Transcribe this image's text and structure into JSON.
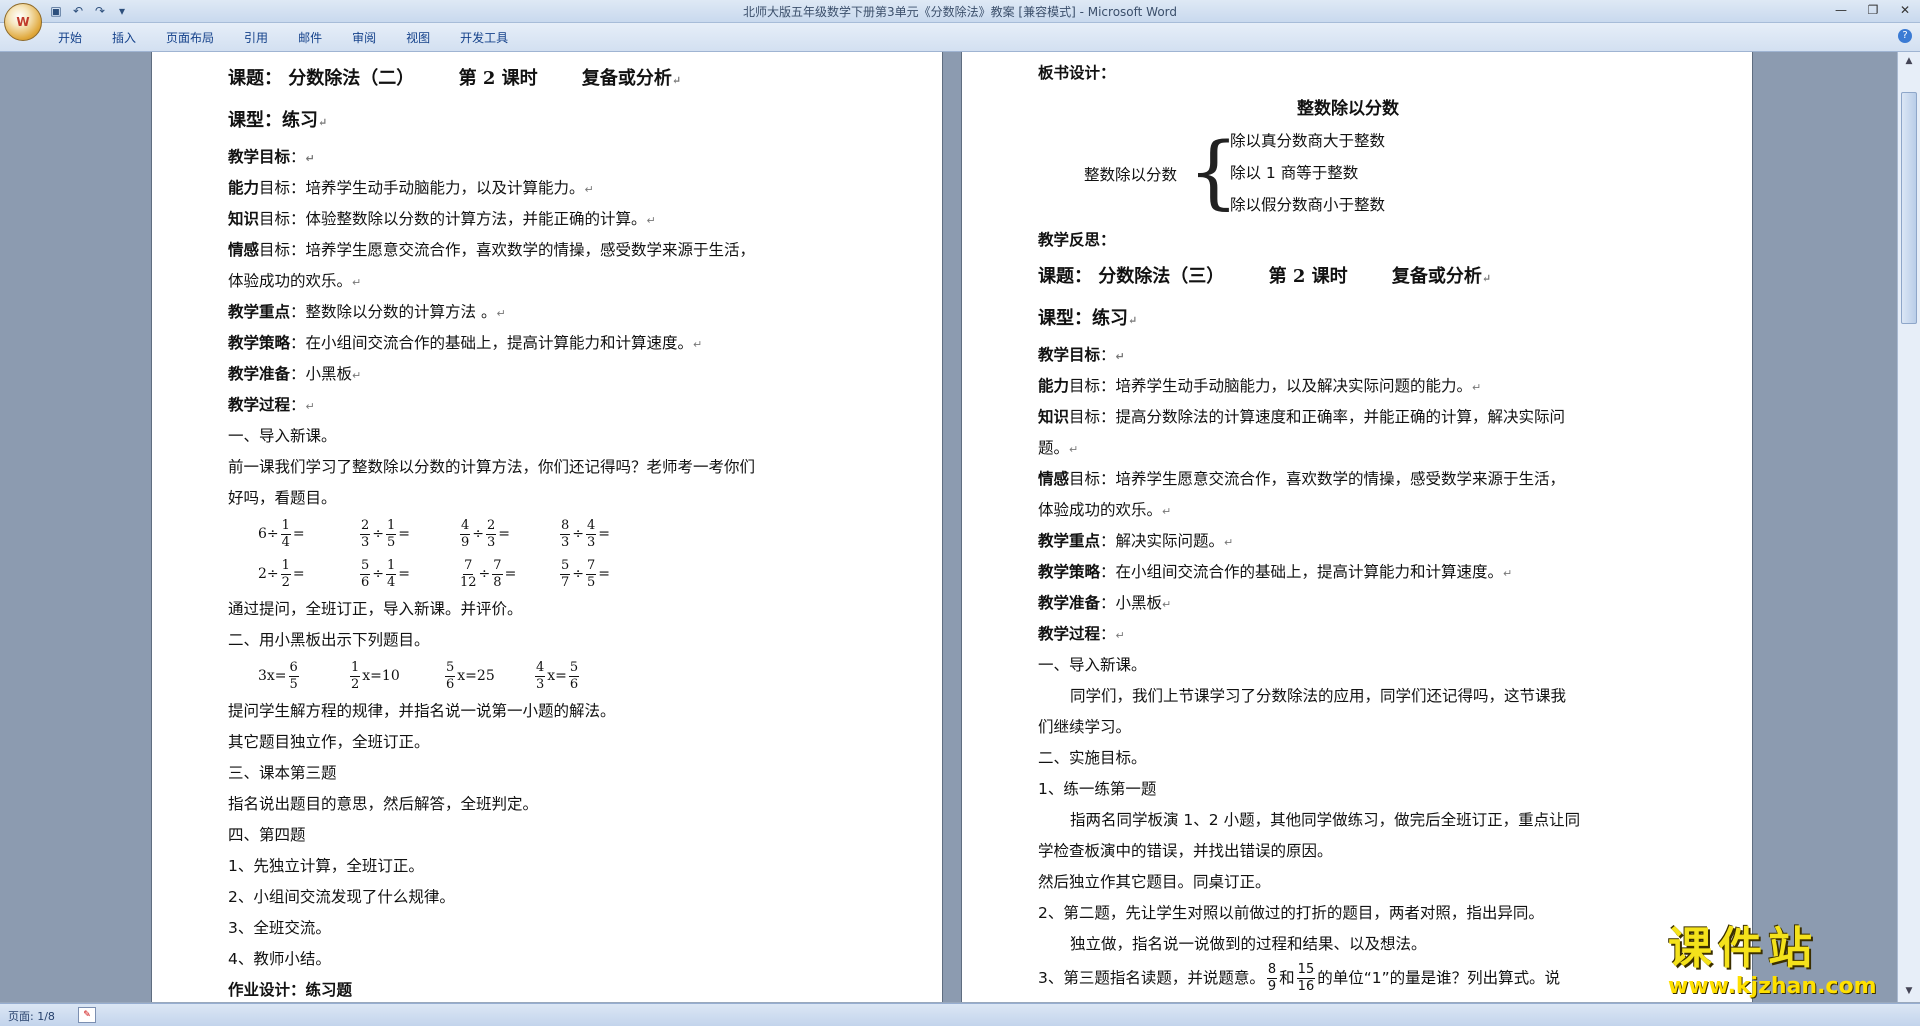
{
  "window": {
    "title": "北师大版五年级数学下册第3单元《分数除法》教案 [兼容模式] - Microsoft Word",
    "office_button_label": "W",
    "qat": [
      "save-icon",
      "undo-icon",
      "redo-icon",
      "customize-icon"
    ],
    "controls": [
      "—",
      "❐",
      "✕"
    ]
  },
  "ribbon_tabs": [
    "开始",
    "插入",
    "页面布局",
    "引用",
    "邮件",
    "审阅",
    "视图",
    "开发工具"
  ],
  "page1": {
    "title": [
      "课题：",
      "分数除法（二）",
      "第 2 课时",
      "复备或分析"
    ],
    "type_label": "课型：",
    "type_value": "练习",
    "objectives_label": "教学目标",
    "line_ability_b": "能力",
    "line_ability": "目标：培养学生动手动脑能力，以及计算能力。",
    "line_know_b": "知识",
    "line_know": "目标：体验整数除以分数的计算方法，并能正确的计算。",
    "line_emotion_b": "情感",
    "line_emotion": "目标：培养学生愿意交流合作，喜欢数学的情操，感受数学来源于生活，",
    "line_emotion2": "体验成功的欢乐。",
    "focus_b": "教学重点",
    "focus": "：整数除以分数的计算方法 。",
    "strategy_b": "教学策略",
    "strategy": "：在小组间交流合作的基础上，提高计算能力和计算速度。",
    "prep_b": "教学准备",
    "prep": "：小黑板",
    "process_b": "教学过程",
    "s1": "一、导入新课。",
    "s1a": "前一课我们学习了整数除以分数的计算方法，你们还记得吗？老师考一考你们",
    "s1b": "好吗，看题目。",
    "row1": [
      {
        "lead": "6÷",
        "n": "1",
        "d": "4",
        "tail": "="
      },
      {
        "n": "2",
        "d": "3",
        "op": "÷",
        "n2": "1",
        "d2": "5",
        "tail": "="
      },
      {
        "n": "4",
        "d": "9",
        "op": "÷",
        "n2": "2",
        "d2": "3",
        "tail": "="
      },
      {
        "n": "8",
        "d": "3",
        "op": "÷",
        "n2": "4",
        "d2": "3",
        "tail": "="
      }
    ],
    "row2": [
      {
        "lead": "2÷",
        "n": "1",
        "d": "2",
        "tail": "="
      },
      {
        "n": "5",
        "d": "6",
        "op": "÷",
        "n2": "1",
        "d2": "4",
        "tail": "="
      },
      {
        "n": "7",
        "d": "12",
        "op": "÷",
        "n2": "7",
        "d2": "8",
        "tail": "="
      },
      {
        "n": "5",
        "d": "7",
        "op": "÷",
        "n2": "7",
        "d2": "5",
        "tail": "="
      }
    ],
    "s1c": "通过提问，全班订正，导入新课。并评价。",
    "s2": "二、用小黑板出示下列题目。",
    "eq": [
      {
        "lead": "3x=",
        "n": "6",
        "d": "5",
        "tail": ""
      },
      {
        "lead": "",
        "n": "1",
        "d": "2",
        "tail": "x=10"
      },
      {
        "lead": "",
        "n": "5",
        "d": "6",
        "tail": "x=25"
      },
      {
        "lead": "",
        "n": "4",
        "d": "3",
        "tail": "x=",
        "n2": "5",
        "d2": "6"
      }
    ],
    "s2a": "提问学生解方程的规律，并指名说一说第一小题的解法。",
    "s2b": "其它题目独立作，全班订正。",
    "s3": "三、课本第三题",
    "s3a": "指名说出题目的意思，然后解答，全班判定。",
    "s4": "四、第四题",
    "s4a": "1、先独立计算，全班订正。",
    "s4b": "2、小组间交流发现了什么规律。",
    "s4c": "3、全班交流。",
    "s4d": "4、教师小结。",
    "hw": "作业设计：练习题"
  },
  "page2": {
    "board_label": "板书设计：",
    "board_title": "整数除以分数",
    "board_left": "整数除以分数",
    "board_items": [
      "除以真分数商大于整数",
      "除以 1 商等于整数",
      "除以假分数商小于整数"
    ],
    "reflect": "教学反思：",
    "title": [
      "课题：",
      "分数除法（三）",
      "第 2 课时",
      "复备或分析"
    ],
    "type_label": "课型：",
    "type_value": "练习",
    "objectives_label": "教学目标",
    "line_ability_b": "能力",
    "line_ability": "目标：培养学生动手动脑能力，以及解决实际问题的能力。",
    "line_know_b": "知识",
    "line_know": "目标：提高分数除法的计算速度和正确率，并能正确的计算，解决实际问",
    "line_know2": "题。",
    "line_emotion_b": "情感",
    "line_emotion": "目标：培养学生愿意交流合作，喜欢数学的情操，感受数学来源于生活，",
    "line_emotion2": "体验成功的欢乐。",
    "focus_b": "教学重点",
    "focus": "：解决实际问题。",
    "strategy_b": "教学策略",
    "strategy": "：在小组间交流合作的基础上，提高计算能力和计算速度。",
    "prep_b": "教学准备",
    "prep": "：小黑板",
    "process_b": "教学过程",
    "s1": "一、导入新课。",
    "s1a": "同学们，我们上节课学习了分数除法的应用，同学们还记得吗，这节课我",
    "s1b": "们继续学习。",
    "s2": "二、实施目标。",
    "s2a": "1、练一练第一题",
    "s2b": "指两名同学板演 1、2 小题，其他同学做练习，做完后全班订正，重点让同",
    "s2c": "学检查板演中的错误，并找出错误的原因。",
    "s2d": "然后独立作其它题目。同桌订正。",
    "s2e": "2、第二题，先让学生对照以前做过的打折的题目，两者对照，指出异同。",
    "s2f": "独立做，指名说一说做到的过程和结果、以及想法。",
    "s3_pre": "3、第三题指名读题，并说题意。",
    "s3_f1n": "8",
    "s3_f1d": "9",
    "s3_and": "和",
    "s3_f2n": "15",
    "s3_f2d": "16",
    "s3_post": "的单位“1”的量是谁？列出算式。说"
  },
  "status": {
    "page": "页面: 1/8",
    "proof_icon": "proofing-icon"
  },
  "watermark": {
    "big": "课件站",
    "small": "www.kjzhan.com"
  },
  "colors": {
    "background": "#8c9bb0",
    "ribbon": "#d3e0f1",
    "title_text": "#15428b",
    "watermark": "#f4e21b"
  }
}
